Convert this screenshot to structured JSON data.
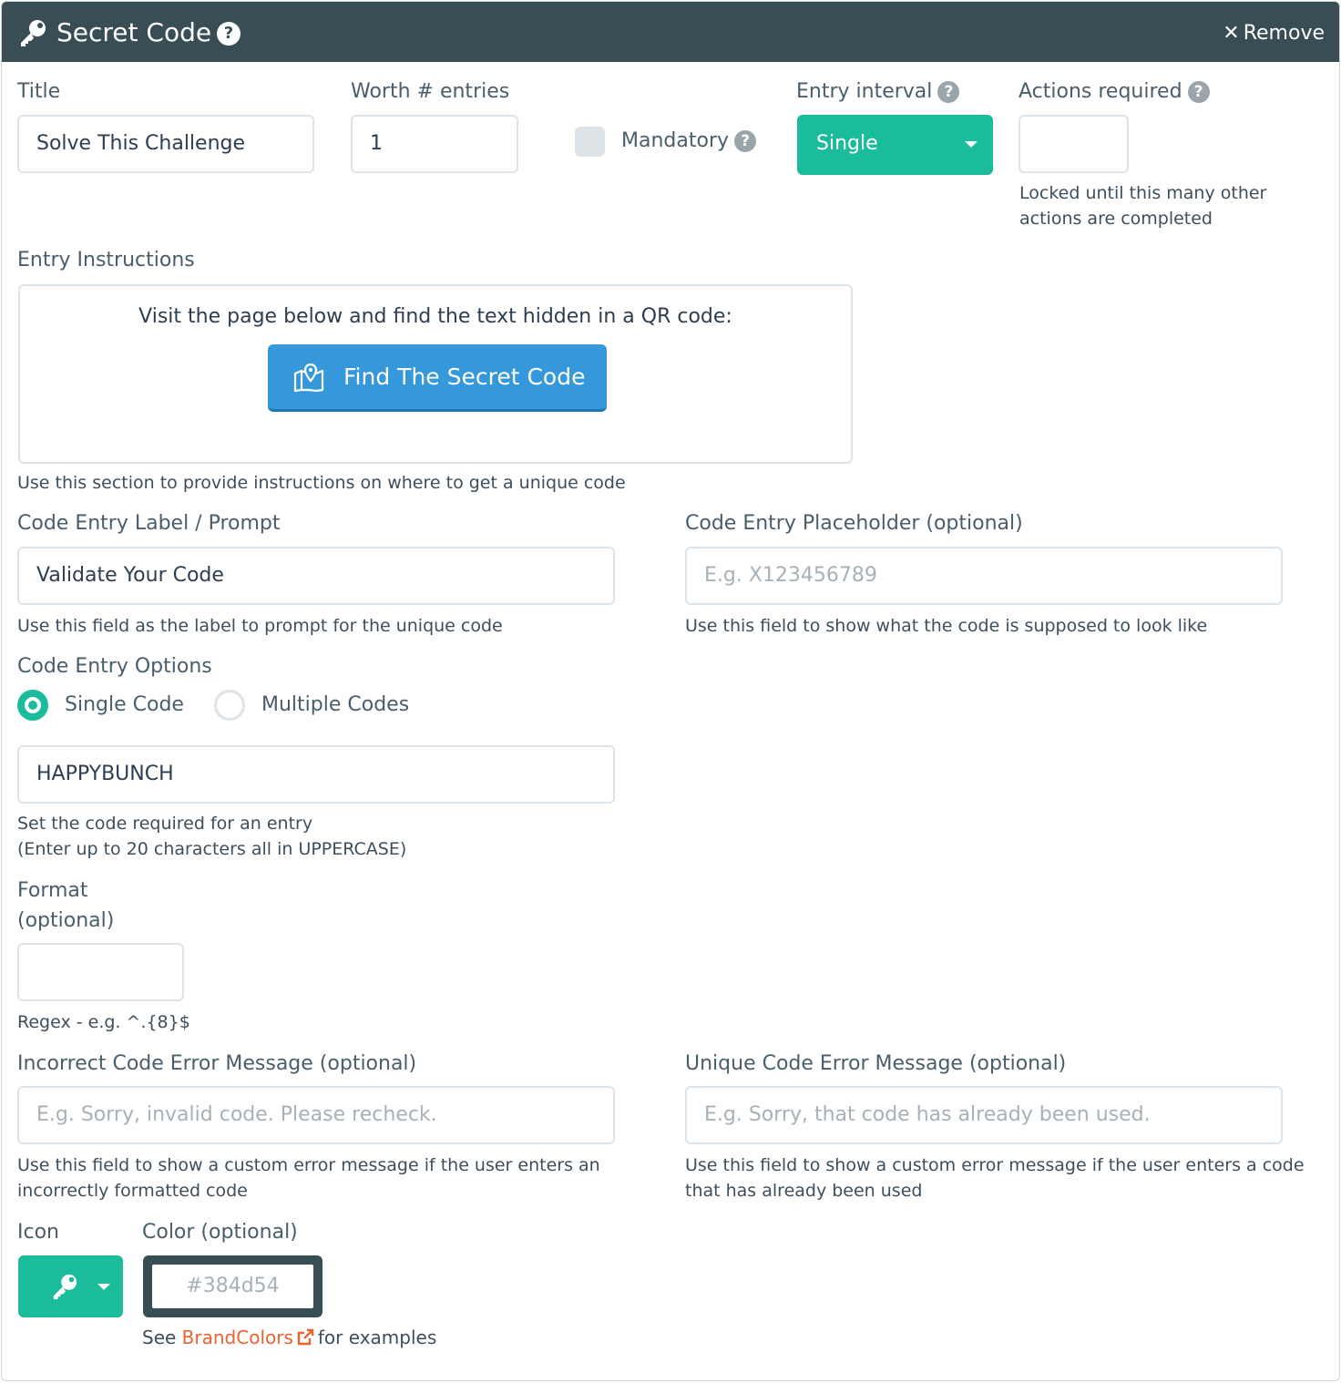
{
  "header": {
    "title": "Secret Code",
    "help_glyph": "?",
    "remove_label": "Remove",
    "icon": "key-icon",
    "background": "#384d54"
  },
  "fields": {
    "title": {
      "label": "Title",
      "value": "Solve This Challenge"
    },
    "worth": {
      "label": "Worth # entries",
      "value": "1"
    },
    "mandatory": {
      "label": "Mandatory",
      "checked": false
    },
    "entry_interval": {
      "label": "Entry interval",
      "value": "Single"
    },
    "actions_required": {
      "label": "Actions required",
      "value": "",
      "hint": "Locked until this many other actions are completed"
    }
  },
  "instructions": {
    "label": "Entry Instructions",
    "text": "Visit the page below and find the text hidden in a QR code:",
    "button_label": "Find The Secret Code",
    "hint": "Use this section to provide instructions on where to get a unique code"
  },
  "code_entry": {
    "label_title": "Code Entry Label / Prompt",
    "label_value": "Validate Your Code",
    "label_hint": "Use this field as the label to prompt for the unique code",
    "placeholder_title": "Code Entry Placeholder (optional)",
    "placeholder_placeholder": "E.g. X123456789",
    "placeholder_hint": "Use this field to show what the code is supposed to look like"
  },
  "options": {
    "title": "Code Entry Options",
    "single_label": "Single Code",
    "multiple_label": "Multiple Codes",
    "selected": "single",
    "code_value": "HAPPYBUNCH",
    "code_hint_1": "Set the code required for an entry",
    "code_hint_2": "(Enter up to 20 characters all in UPPERCASE)"
  },
  "format": {
    "label_1": "Format",
    "label_2": "(optional)",
    "value": "",
    "hint": "Regex - e.g. ^.{8}$"
  },
  "errors": {
    "incorrect_title": "Incorrect Code Error Message (optional)",
    "incorrect_placeholder": "E.g. Sorry, invalid code. Please recheck.",
    "incorrect_hint": "Use this field to show a custom error message if the user enters an incorrectly formatted code",
    "unique_title": "Unique Code Error Message (optional)",
    "unique_placeholder": "E.g. Sorry, that code has already been used.",
    "unique_hint": "Use this field to show a custom error message if the user enters a code that has already been used"
  },
  "appearance": {
    "icon_label": "Icon",
    "color_label": "Color (optional)",
    "color_placeholder": "#384d54",
    "see_prefix": "See",
    "link_text": "BrandColors",
    "see_suffix": "for examples",
    "accent": "#1bbc9b",
    "link_color": "#e9622f"
  }
}
